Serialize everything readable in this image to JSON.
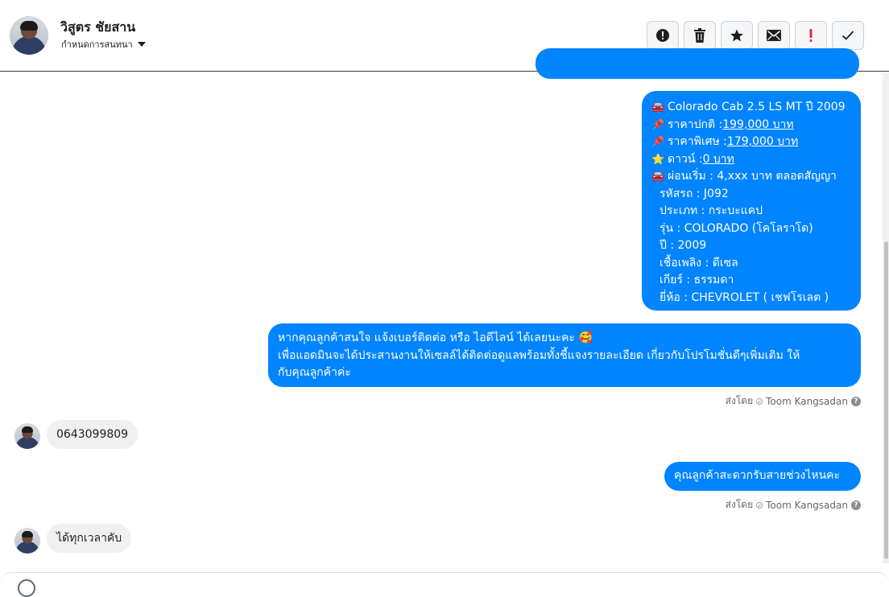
{
  "header": {
    "contact_name": "วิสูตร ชัยสาน",
    "assign_label": "กำหนดการสนทนา"
  },
  "toolbar": {
    "buttons": [
      {
        "name": "spam-button",
        "icon": "alert-circle-icon"
      },
      {
        "name": "delete-button",
        "icon": "trash-icon"
      },
      {
        "name": "star-button",
        "icon": "star-icon"
      },
      {
        "name": "mark-unread-button",
        "icon": "envelope-icon"
      },
      {
        "name": "important-button",
        "icon": "exclamation-icon"
      },
      {
        "name": "done-button",
        "icon": "checkmark-icon"
      }
    ]
  },
  "messages": {
    "product": {
      "title": "Colorado Cab 2.5 LS MT ปี 2009",
      "price_normal_label": "ราคาปกติ : ",
      "price_normal_value": "199,000 บาท",
      "price_special_label": "ราคาพิเศษ : ",
      "price_special_value": "179,000 บาท",
      "down_label": "ดาวน์ : ",
      "down_value": "0 บาท",
      "installment": "ผ่อนเริ่ม : 4,xxx บาท ตลอดสัญญา",
      "code": "รหัสรถ : J092",
      "type": "ประเภท : กระบะแคป",
      "model": "รุ่น : COLORADO (โคโลราโด)",
      "year": "ปี : 2009",
      "fuel": "เชื้อเพลิง : ดีเซล",
      "gear": "เกียร์ : ธรรมดา",
      "brand": "ยี่ห้อ : CHEVROLET ( เชฟโรเลต )"
    },
    "pitch": {
      "line1": "หากคุณลูกค้าสนใจ แจ้งเบอร์ติดต่อ หรือ ไอดีไลน์ ได้เลยนะคะ 🥰",
      "line2": "เพื่อแอดมินจะได้ประสานงานให้เซลล์ได้ติดต่อดูแลพร้อมทั้งชี้แจงรายละเอียด เกี่ยวกับโปรโมชั่นดีๆเพิ่มเติม ให้",
      "line3": "กับคุณลูกค้าค่ะ"
    },
    "sent_by_label": "ส่งโดย",
    "sender": "Toom Kangsadan",
    "incoming_phone": "0643099809",
    "ask_time": "คุณลูกค้าสะดวกรับสายช่วงไหนคะ",
    "incoming_reply": "ได้ทุกเวลาคับ"
  },
  "colors": {
    "outgoing_bubble": "#0084ff",
    "incoming_bubble": "#f0f0f0"
  }
}
